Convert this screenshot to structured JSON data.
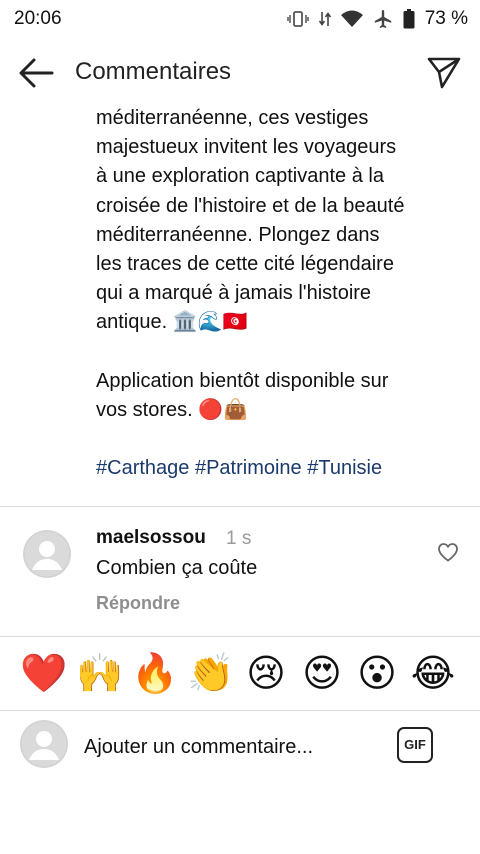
{
  "status_bar": {
    "time": "20:06",
    "battery_percent": "73 %",
    "icons": [
      "vibrate-icon",
      "data-arrows-icon",
      "wifi-icon",
      "airplane-icon",
      "battery-icon"
    ]
  },
  "header": {
    "title": "Commentaires",
    "back_icon": "arrow-left-icon",
    "share_icon": "send-icon"
  },
  "caption": {
    "lines": [
      "méditerranéenne, ces vestiges",
      "majestueux invitent les voyageurs",
      "à une exploration captivante à la",
      "croisée de l'histoire et de la beauté",
      "méditerranéenne. Plongez dans",
      "les traces de cette cité légendaire",
      "qui a marqué à jamais l'histoire",
      "antique. 🏛️🌊🇹🇳"
    ],
    "announcement_lines": [
      "Application bientôt disponible sur",
      "vos stores. 🔴👜"
    ],
    "hashtags": "#Carthage #Patrimoine #Tunisie"
  },
  "comment": {
    "username": "maelsossou",
    "time": "1 s",
    "text": "Combien ça coûte",
    "reply_label": "Répondre"
  },
  "quick_reactions": [
    "❤️",
    "🙌",
    "🔥",
    "👏",
    "😢",
    "😍",
    "😮",
    "😂"
  ],
  "composer": {
    "placeholder": "Ajouter un commentaire...",
    "gif_label": "GIF"
  },
  "colors": {
    "hashtag": "#1a3a6b",
    "divider": "#dbdbdb",
    "muted": "#8e8e8e"
  }
}
